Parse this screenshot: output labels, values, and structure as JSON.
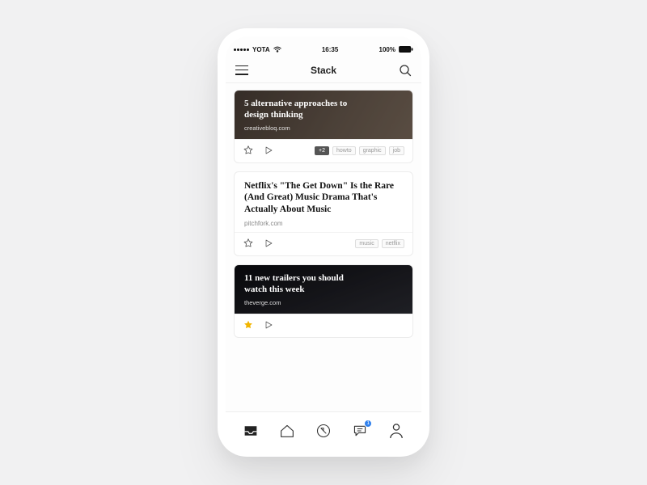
{
  "status": {
    "carrier": "YOTA",
    "time": "16:35",
    "battery_pct": "100%"
  },
  "header": {
    "title": "Stack"
  },
  "cards": [
    {
      "title": "5 alternative approaches to design thinking",
      "source": "creativebloq.com",
      "starred": false,
      "extra_tags_count": "+2",
      "tags": [
        "howto",
        "graphic",
        "job"
      ]
    },
    {
      "title": "Netflix's \"The Get Down\" Is the Rare (And Great) Music Drama That's Actually About Music",
      "source": "pitchfork.com",
      "starred": false,
      "tags": [
        "music",
        "netflix"
      ]
    },
    {
      "title": "11 new trailers you should watch this week",
      "source": "theverge.com",
      "starred": true,
      "tags": []
    }
  ],
  "bottom_nav": {
    "items": [
      "inbox",
      "home",
      "tags",
      "comments",
      "profile"
    ],
    "comments_badge": "1"
  }
}
